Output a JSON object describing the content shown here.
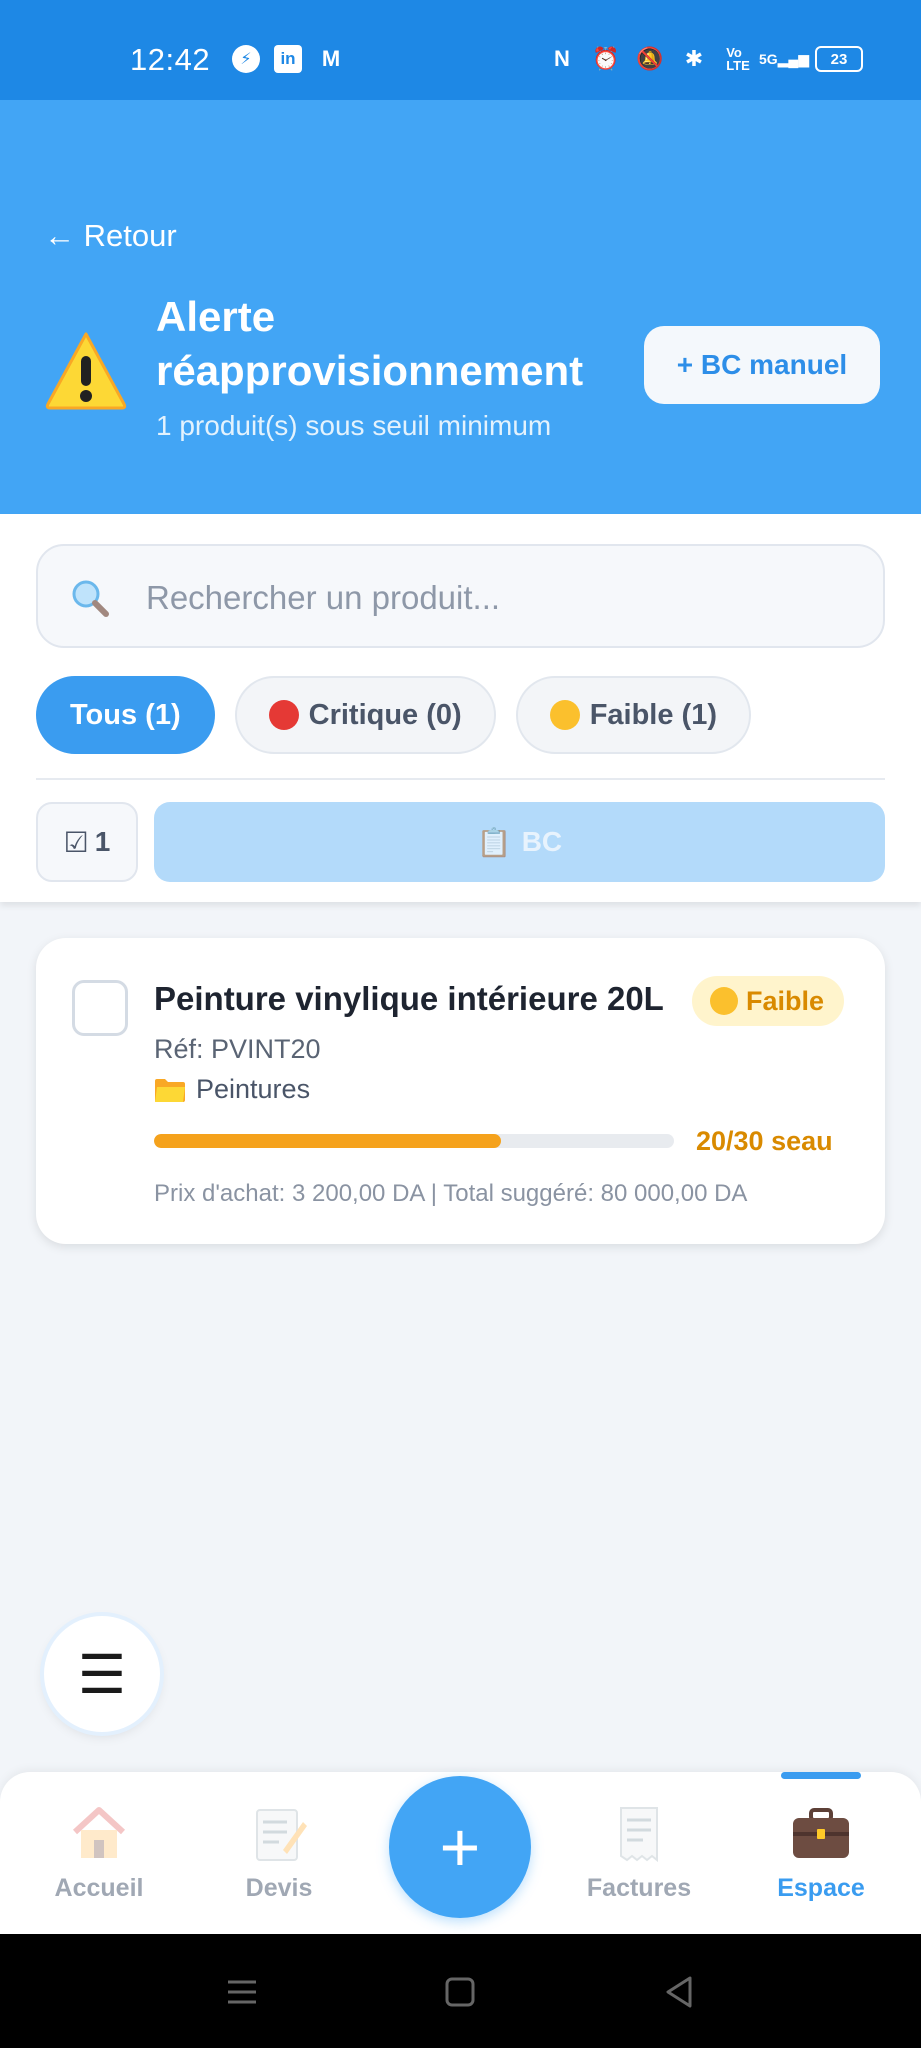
{
  "status_bar": {
    "time": "12:42",
    "network": "5G",
    "battery": "23",
    "volte": "Vo\nLTE"
  },
  "header": {
    "back_label": "← Retour",
    "title": "Alerte réapprovisionnement",
    "subtitle": "1 produit(s) sous seuil minimum",
    "manual_bc_label": "+ BC manuel"
  },
  "search": {
    "placeholder": "Rechercher un produit..."
  },
  "filters": [
    {
      "label": "Tous (1)",
      "active": true
    },
    {
      "label": "Critique (0)",
      "dot": "red"
    },
    {
      "label": "Faible (1)",
      "dot": "yellow"
    }
  ],
  "actions": {
    "selected_count": "1",
    "bc_label": "BC"
  },
  "products": [
    {
      "name": "Peinture vinylique intérieure 20L",
      "status": "Faible",
      "ref": "Réf: PVINT20",
      "category": "Peintures",
      "stock_fraction": 0.667,
      "stock_text": "20/30 seau",
      "price_line": "Prix d'achat: 3 200,00 DA | Total suggéré: 80 000,00 DA"
    }
  ],
  "menu_icon": "☰",
  "bottom_nav": {
    "items": [
      {
        "label": "Accueil",
        "icon": "house-icon"
      },
      {
        "label": "Devis",
        "icon": "memo-icon"
      },
      {
        "label": "Factures",
        "icon": "receipt-icon"
      },
      {
        "label": "Espace",
        "icon": "briefcase-icon",
        "active": true
      }
    ],
    "center_label": "+"
  },
  "colors": {
    "primary": "#42a5f5",
    "status_bar": "#1e88e5",
    "warning": "#f5a21c",
    "critical": "#e53935"
  }
}
